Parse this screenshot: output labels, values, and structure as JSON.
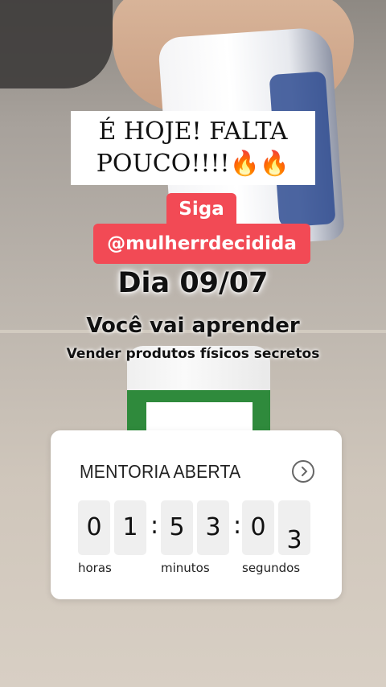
{
  "story": {
    "caption": "É HOJE! FALTA\nPOUCO!!!!🔥🔥",
    "follow_line1": "Siga",
    "follow_line2": "@mulherrdecidida",
    "date": "Dia 09/07",
    "learn_title": "Você vai aprender",
    "learn_subtitle": "Vender produtos físicos secretos"
  },
  "countdown": {
    "title": "MENTORIA ABERTA",
    "action_icon": "chevron-right-circle-icon",
    "hours": [
      "0",
      "1"
    ],
    "minutes": [
      "5",
      "3"
    ],
    "seconds": [
      "0",
      "3"
    ],
    "separator": ":",
    "label_hours": "horas",
    "label_minutes": "minutos",
    "label_seconds": "segundos"
  },
  "colors": {
    "follow_bg": "#f24a55",
    "card_bg": "#ffffff",
    "digit_bg": "#efefef"
  }
}
